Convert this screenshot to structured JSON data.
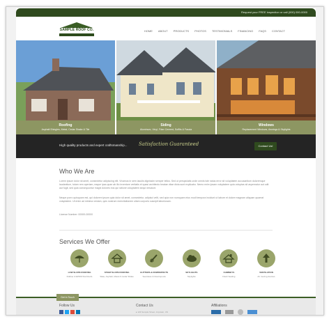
{
  "topbar": {
    "text": "Request your FREE inspection or call (000) 000-0000"
  },
  "logo": {
    "text": "SAMPLE ROOF CO."
  },
  "nav": [
    "Home",
    "About",
    "Products",
    "Photos",
    "Testimonials",
    "Financing",
    "Faqs",
    "Contact"
  ],
  "heroes": [
    {
      "title": "Roofing",
      "subtitle": "Asphalt Shingles, Metal, Cedar Shake & Tile"
    },
    {
      "title": "Siding",
      "subtitle": "Aluminum, Vinyl, Fiber Cement, Soffits & Fascia"
    },
    {
      "title": "Windows",
      "subtitle": "Replacement Windows, Awnings & Skylights"
    }
  ],
  "banner": {
    "text": "High quality products and expert craftsmanship...",
    "script": "Satisfaction Guaranteed",
    "button": "Contact Us!"
  },
  "who": {
    "heading": "Who We Are",
    "p1": "Lorem ipsum dolor sit amet, consectetur adipiscing elit. Vivamus in sem iaculis dignissim semper tellus. Sed ut perspiciatis unde omnis iste natus error sit voluptatem accusantium doloremque laudantium, totam rem aperiam, eaque ipsa quae ab illo inventore veritatis et quasi architecto beatae vitae dicta sunt explicabo. Nemo enim ipsam voluptatem quia voluptas sit aspernatur aut odit aut fugit, sed quia consequuntur magni dolores eos qui ratione voluptatem sequi nesciunt.",
    "p2": "Neque porro quisquam est, qui dolorem ipsum quia dolor sit amet, consectetur, adipisci velit, sed quia non numquam eius modi tempora incidunt ut labore et dolore magnam aliquam quaerat voluptatem. Ut enim ad minima veniam, quis nostrum exercitationem ullam corporis suscipit laboriosam.",
    "license": "License Number: 00000-00000"
  },
  "services": {
    "heading": "Services We Offer",
    "items": [
      {
        "icon": "umbrella-icon",
        "title": "Low Slope Roofing",
        "desc": "Rubber & EPDM Flat Roofs"
      },
      {
        "icon": "house-icon",
        "title": "Steep Slope Roofing",
        "desc": "Slate, Asphalt, Metal & Cedar Shake"
      },
      {
        "icon": "gutter-icon",
        "title": "Gutters & Downspouts",
        "desc": "Seamless & Downspouts"
      },
      {
        "icon": "cloud-icon",
        "title": "Skylights",
        "desc": "Skylights"
      },
      {
        "icon": "chimney-icon",
        "title": "Chimneys",
        "desc": "Flash Sealing"
      },
      {
        "icon": "arrow-up-icon",
        "title": "Ventilation",
        "desc": "Air moving devices"
      }
    ]
  },
  "footer": {
    "tab": "Get In Touch",
    "follow": "Follow Us",
    "contact": "Contact Us",
    "contact_line": "▸ 123 Sample Street, Anytown, US",
    "affiliations": "Affiliations"
  },
  "colors": {
    "brand_green": "#2f4a1e",
    "olive": "#8d9662",
    "dark_banner": "#242424"
  }
}
